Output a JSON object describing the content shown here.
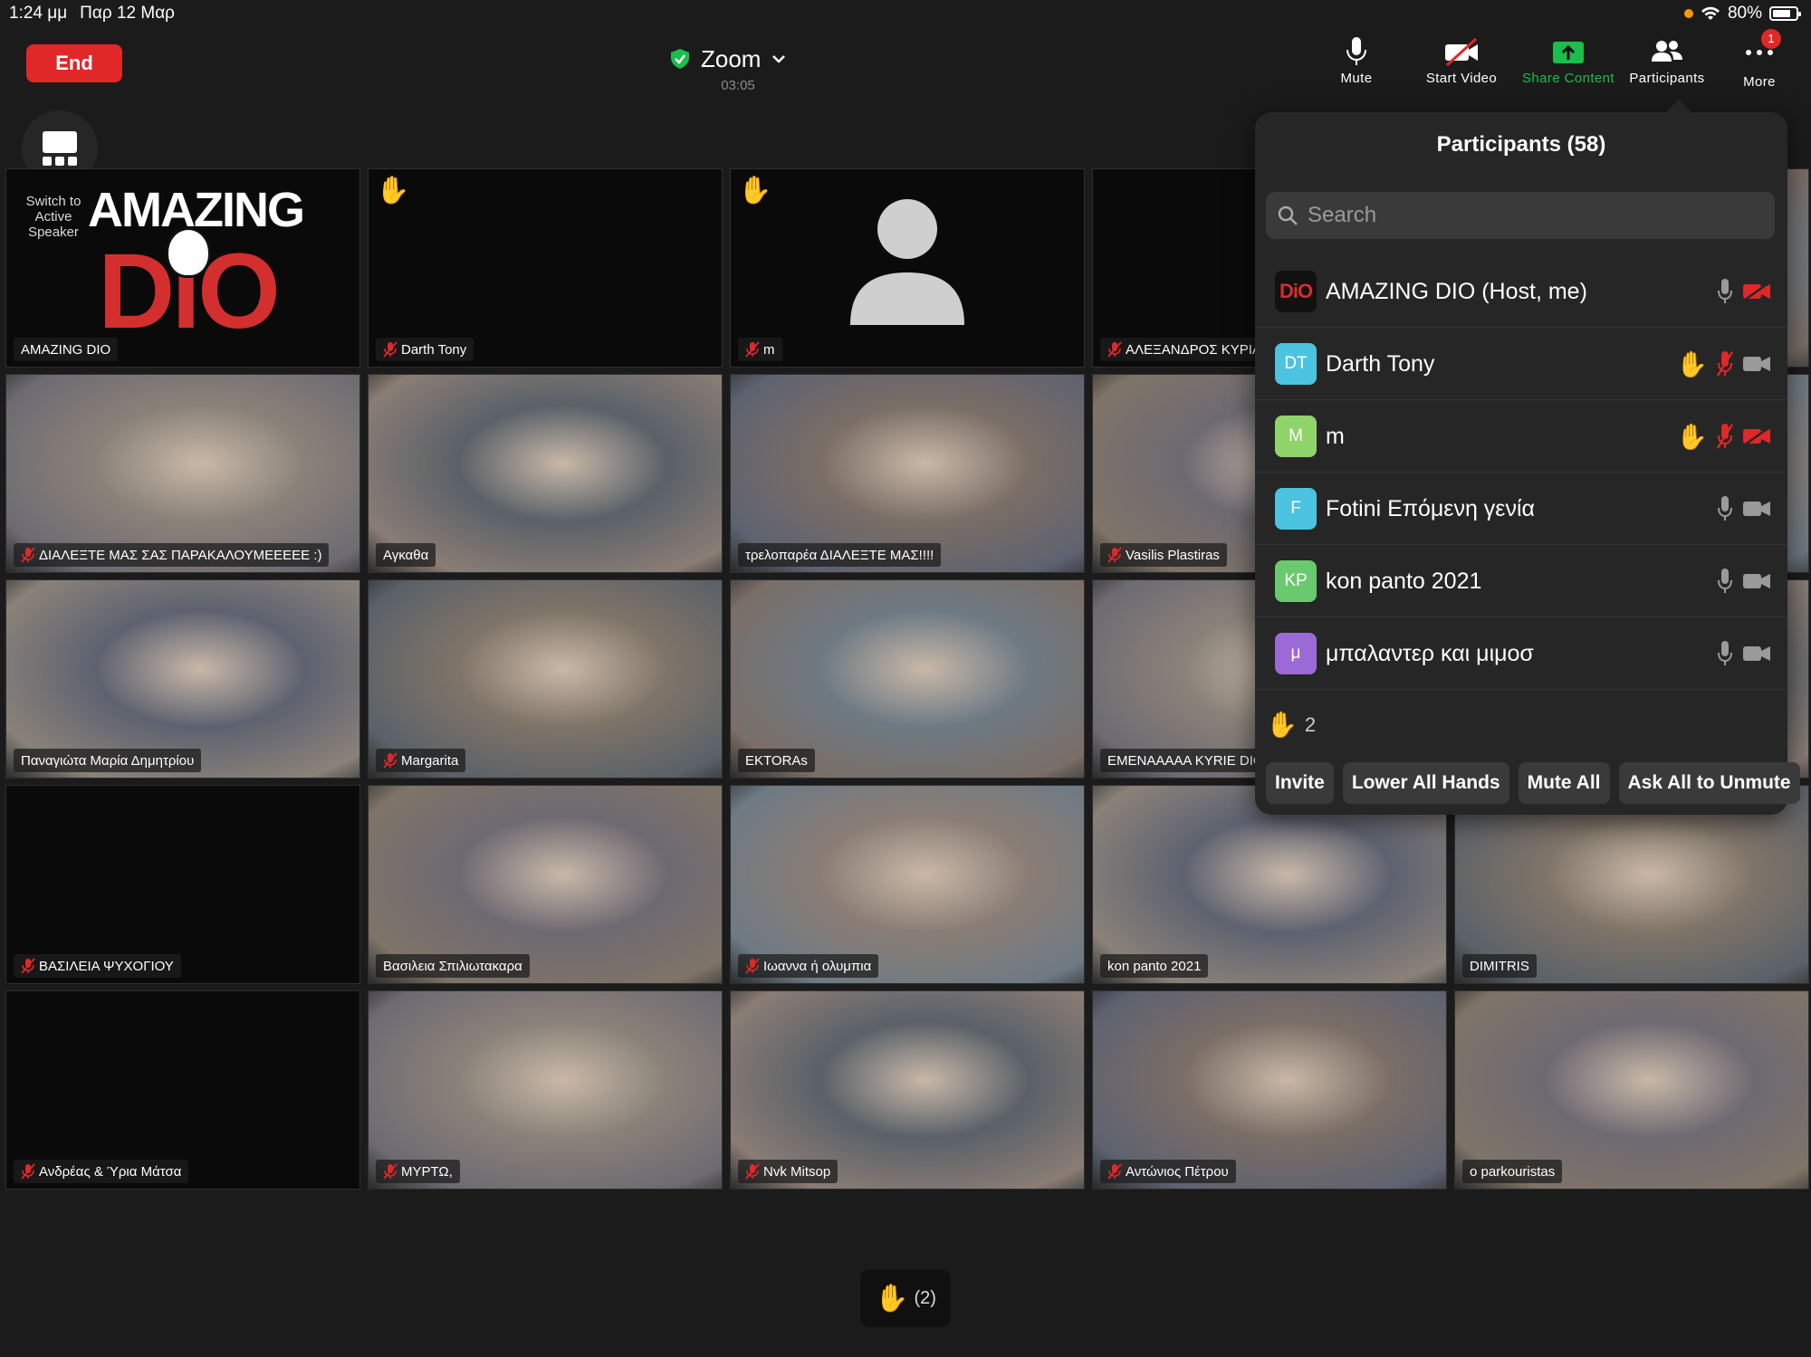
{
  "status_bar": {
    "time": "1:24 μμ",
    "date": "Παρ 12 Μαρ",
    "battery": "80%",
    "battery_level": 0.8
  },
  "toolbar": {
    "end_label": "End",
    "meeting_title": "Zoom",
    "meeting_timer": "03:05",
    "mute_label": "Mute",
    "start_video_label": "Start Video",
    "share_label": "Share Content",
    "participants_label": "Participants",
    "more_label": "More",
    "more_badge": "1",
    "share_color": "#1bbd4b"
  },
  "switch_view": {
    "label": "Switch to Active Speaker"
  },
  "tiles": [
    {
      "name": "AMAZING DIO",
      "muted": false,
      "hand": false,
      "kind": "logo"
    },
    {
      "name": "Darth Tony",
      "muted": true,
      "hand": true,
      "kind": "black"
    },
    {
      "name": "m",
      "muted": true,
      "hand": true,
      "kind": "avatar"
    },
    {
      "name": "ΑΛΕΞΑΝΔΡΟΣ ΚΥΡΙΑΚΟ",
      "muted": true,
      "hand": false,
      "kind": "black"
    },
    {
      "name": "",
      "muted": false,
      "hand": false,
      "kind": "video"
    },
    {
      "name": "ΔΙΑΛΕΞΤΕ ΜΑΣ ΣΑΣ ΠΑΡΑΚΑΛΟΥΜΕΕΕΕΕ :)",
      "muted": true,
      "hand": false,
      "kind": "video"
    },
    {
      "name": "Αγκαθα",
      "muted": false,
      "hand": false,
      "kind": "video"
    },
    {
      "name": "τρελοπαρέα ΔΙΑΛΕΞΤΕ ΜΑΣ!!!!",
      "muted": false,
      "hand": false,
      "kind": "video"
    },
    {
      "name": "Vasilis Plastiras",
      "muted": true,
      "hand": false,
      "kind": "video"
    },
    {
      "name": "",
      "muted": false,
      "hand": false,
      "kind": "video"
    },
    {
      "name": "Παναγιώτα Μαρία Δημητρίου",
      "muted": false,
      "hand": false,
      "kind": "video"
    },
    {
      "name": "Margarita",
      "muted": true,
      "hand": false,
      "kind": "video"
    },
    {
      "name": "EKTORAs",
      "muted": false,
      "hand": false,
      "kind": "video"
    },
    {
      "name": "EMENAAAAA KYRIE DIO",
      "muted": false,
      "hand": false,
      "kind": "video"
    },
    {
      "name": "",
      "muted": false,
      "hand": false,
      "kind": "video"
    },
    {
      "name": "ΒΑΣΙΛΕΙΑ ΨΥΧΟΓΙΟΥ",
      "muted": true,
      "hand": false,
      "kind": "black"
    },
    {
      "name": "Βασιλεια Σπιλιωτακαρα",
      "muted": false,
      "hand": false,
      "kind": "video"
    },
    {
      "name": "Ιωαννα ή ολυμπια",
      "muted": true,
      "hand": false,
      "kind": "video"
    },
    {
      "name": "kon panto 2021",
      "muted": false,
      "hand": false,
      "kind": "video"
    },
    {
      "name": "DIMITRIS",
      "muted": false,
      "hand": false,
      "kind": "video"
    },
    {
      "name": "Ανδρέας & Ύρια Μάτσα",
      "muted": true,
      "hand": false,
      "kind": "black"
    },
    {
      "name": "ΜΥΡΤΩ,",
      "muted": true,
      "hand": false,
      "kind": "video"
    },
    {
      "name": "Nvk Mitsop",
      "muted": true,
      "hand": false,
      "kind": "video"
    },
    {
      "name": "Αντώνιος Πέτρου",
      "muted": true,
      "hand": false,
      "kind": "video"
    },
    {
      "name": "o parkouristas",
      "muted": false,
      "hand": false,
      "kind": "video"
    }
  ],
  "participants_panel": {
    "title": "Participants (58)",
    "search_placeholder": "Search",
    "rows": [
      {
        "initials": "",
        "name": "AMAZING DIO (Host, me)",
        "color": "#111111",
        "hand": false,
        "mic_muted": false,
        "video_off": true,
        "is_logo": true
      },
      {
        "initials": "DT",
        "name": "Darth Tony",
        "color": "#4cc3e0",
        "hand": true,
        "mic_muted": true,
        "video_off": false
      },
      {
        "initials": "M",
        "name": "m",
        "color": "#8fd36b",
        "hand": true,
        "mic_muted": true,
        "video_off": true
      },
      {
        "initials": "F",
        "name": "Fotini Επόμενη γενία",
        "color": "#4cc3e0",
        "hand": false,
        "mic_muted": false,
        "video_off": false
      },
      {
        "initials": "KP",
        "name": "kon panto 2021",
        "color": "#6ac96e",
        "hand": false,
        "mic_muted": false,
        "video_off": false
      },
      {
        "initials": "μ",
        "name": "μπαλαντερ και μιμοσ",
        "color": "#9b6ad6",
        "hand": false,
        "mic_muted": false,
        "video_off": false
      }
    ],
    "raised_count": "2",
    "buttons": {
      "invite": "Invite",
      "lower_all": "Lower All Hands",
      "mute_all": "Mute All",
      "ask_unmute": "Ask All to Unmute"
    }
  },
  "bottom_hands": {
    "label": "(2)"
  },
  "colors": {
    "end": "#e02828",
    "muted": "#e02828",
    "panel": "#262626"
  }
}
